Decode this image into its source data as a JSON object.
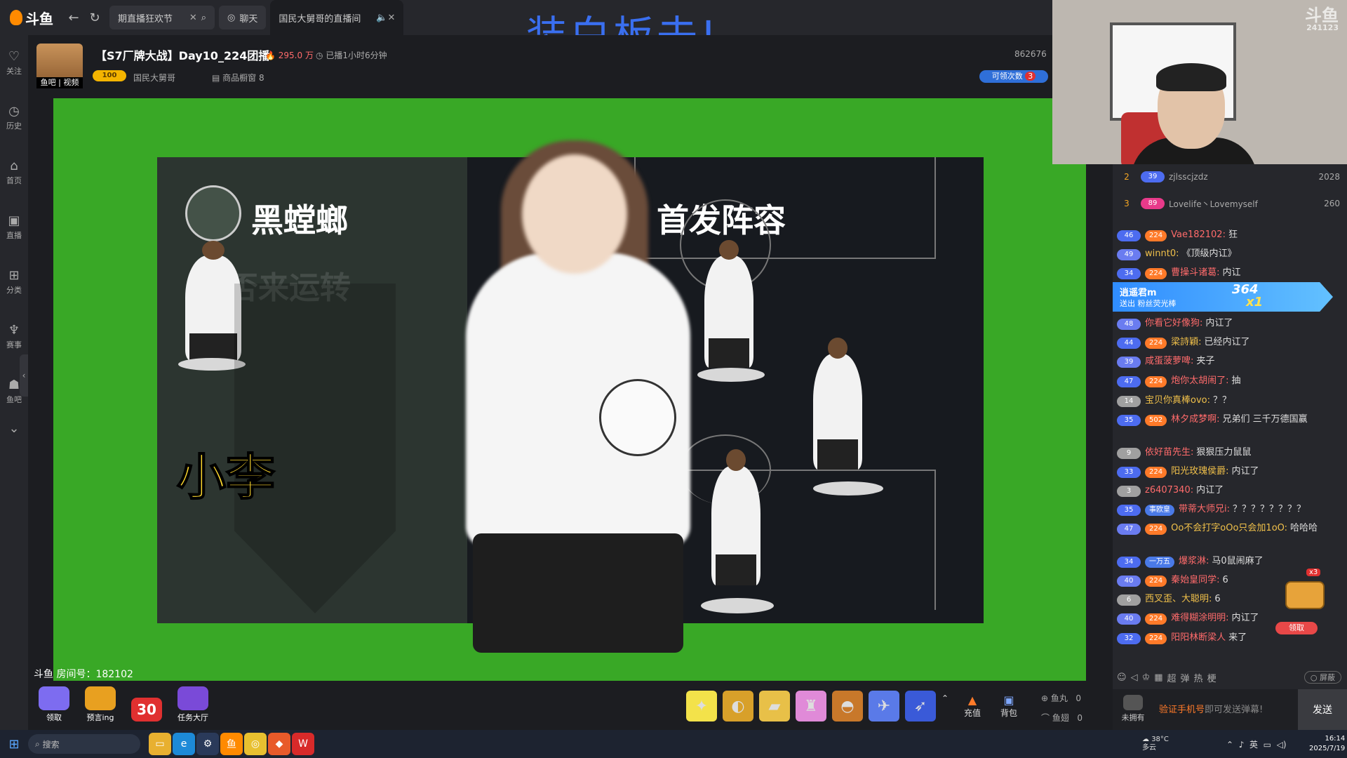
{
  "topbar": {
    "logo": "斗鱼",
    "search_value": "期直播狂欢节",
    "chat_tab": "聊天",
    "active_tab": "国民大舅哥的直播间"
  },
  "overlay": {
    "banner_text": "装白板去!"
  },
  "leftnav": {
    "items": [
      "关注",
      "历史",
      "首页",
      "直播",
      "分类",
      "赛事",
      "鱼吧"
    ]
  },
  "room": {
    "avatar_caption": "鱼吧 | 视频",
    "title": "【S7厂牌大战】Day10_224团播",
    "heat": "295.0 万",
    "live_duration": "已播1小时6分钟",
    "level_badge": "100",
    "host_name": "国民大舅哥",
    "shop": "商品橱窗 8",
    "room_number": "862676",
    "claim_label": "可领次数",
    "claim_count": "3"
  },
  "video": {
    "team_name": "黑螳螂",
    "watermark": "否来运转",
    "player_name": "小李",
    "lineup_title": "首发阵容",
    "room_id_label": "斗鱼 房间号：182102"
  },
  "toolbar": {
    "activities": [
      "领取",
      "预言ing",
      "30",
      "任务大厅"
    ],
    "recharge": "充值",
    "backpack": "背包",
    "fish_balls_label": "鱼丸",
    "fish_balls_value": "0",
    "fish_wings_label": "鱼翅",
    "fish_wings_value": "0"
  },
  "webcam": {
    "logo": "斗鱼",
    "id": "241123"
  },
  "chat": {
    "ranks": [
      {
        "no": "2",
        "level": "39",
        "name": "zjlsscjzdz",
        "score": "2028"
      },
      {
        "no": "3",
        "level": "89",
        "name": "Lovelife丶Lovemyself",
        "score": "260"
      }
    ],
    "gift_banner": {
      "name": "逍遥君m",
      "sub": "送出  粉丝荧光棒",
      "combo": "364",
      "times": "x1"
    },
    "messages": [
      {
        "level": "46",
        "fan": "224",
        "user": "Vae182102:",
        "text": "狂"
      },
      {
        "level": "49",
        "fan": "",
        "user": "winnt0:",
        "text": "《顶级内讧》"
      },
      {
        "level": "34",
        "fan": "224",
        "user": "曹操斗诸葛:",
        "text": "内讧"
      },
      {
        "level": "48",
        "fan": "",
        "user": "你看它好像狗:",
        "text": "内讧了"
      },
      {
        "level": "44",
        "fan": "224",
        "user": "梁詩穎:",
        "text": "已经内讧了"
      },
      {
        "level": "39",
        "fan": "",
        "user": "咸蛋菠萝啤:",
        "text": "夹子"
      },
      {
        "level": "47",
        "fan": "224",
        "user": "炮你太胡闹了:",
        "text": "抽"
      },
      {
        "level": "14",
        "fan": "",
        "user": "宝贝你真棒ovo:",
        "text": "？？"
      },
      {
        "level": "35",
        "fan": "502",
        "user": "林夕成梦啊:",
        "text": "兄弟们 三千万德国赢"
      },
      {
        "level": "9",
        "fan": "",
        "user": "依好苗先生:",
        "text": "狠狠压力鼠鼠"
      },
      {
        "level": "33",
        "fan": "224",
        "user": "阳光玫瑰侯爵:",
        "text": "内讧了"
      },
      {
        "level": "3",
        "fan": "",
        "user": "z6407340:",
        "text": "内讧了"
      },
      {
        "level": "35",
        "fan": "事欧皇",
        "user": "带蒂大师兄i:",
        "text": "？？？？？？？？"
      },
      {
        "level": "47",
        "fan": "224",
        "user": "Oo不会打字oOo只会加1oO:",
        "text": "哈哈哈"
      },
      {
        "level": "34",
        "fan": "一万五",
        "user": "爆浆淋:",
        "text": "马0鼠闹麻了"
      },
      {
        "level": "40",
        "fan": "224",
        "user": "秦始皇同学:",
        "text": "6"
      },
      {
        "level": "6",
        "fan": "",
        "user": "西叉歪、大聪明:",
        "text": "6"
      },
      {
        "level": "40",
        "fan": "224",
        "user": "难得糊涂明明:",
        "text": "内讧了"
      },
      {
        "level": "32",
        "fan": "224",
        "user": "阳阳林断梁人",
        "text": "来了"
      }
    ],
    "chest_count": "x3",
    "chest_claim": "领取",
    "tools": [
      "超",
      "弹",
      "热",
      "梗"
    ],
    "shield_label": "屏蔽",
    "unowned_label": "未拥有",
    "hint_prefix": "验证手机号",
    "hint_suffix": "即可发送弹幕!",
    "send_label": "发送"
  },
  "taskbar": {
    "search_placeholder": "搜索",
    "weather_temp": "38°C",
    "weather_desc": "多云",
    "ime": "英",
    "time": "16:14",
    "date": "2025/7/19"
  },
  "colors": {
    "accent": "#ff7a29",
    "green_screen": "#39a826",
    "banner_blue": "#3a6ff0"
  }
}
